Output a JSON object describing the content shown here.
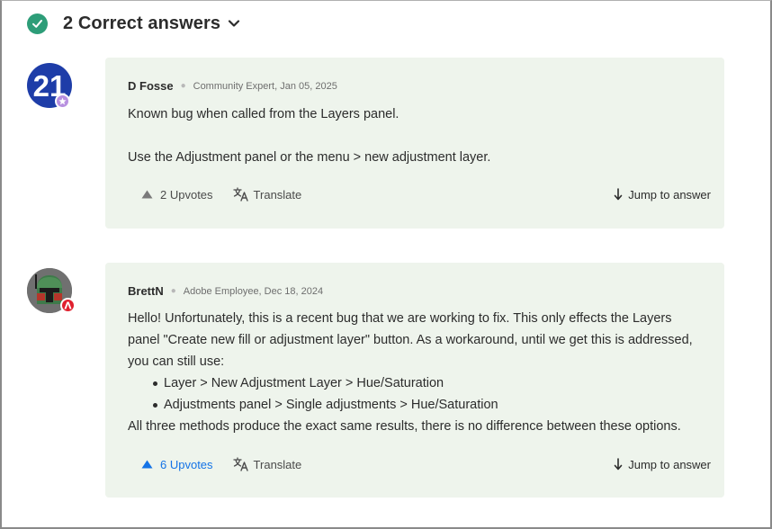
{
  "header": {
    "title": "2 Correct answers",
    "icon": "check-circle-icon",
    "toggle_icon": "chevron-down-icon"
  },
  "answers": [
    {
      "avatar_text": "21",
      "author": "D Fosse",
      "role_date": "Community Expert, Jan 05, 2025",
      "paragraphs": [
        "Known bug when called from the Layers panel.",
        "Use the Adjustment panel or the menu > new adjustment layer."
      ],
      "upvotes": "2 Upvotes",
      "upvoted": false,
      "translate": "Translate",
      "jump": "Jump to answer"
    },
    {
      "author": "BrettN",
      "role_date": "Adobe Employee, Dec 18, 2024",
      "intro": "Hello! Unfortunately, this is a recent bug that we are working to fix. This only effects the Layers panel \"Create new fill or adjustment layer\" button. As a workaround, until we get this is addressed, you can still use:",
      "bullets": [
        "Layer > New Adjustment Layer > Hue/Saturation",
        "Adjustments panel > Single adjustments > Hue/Saturation"
      ],
      "outro": "All three methods produce the exact same results, there is no difference between these options.",
      "upvotes": "6 Upvotes",
      "upvoted": true,
      "translate": "Translate",
      "jump": "Jump to answer"
    }
  ],
  "colors": {
    "accent": "#1473e6",
    "correct": "#2d9d78",
    "card_bg": "#eef4ec",
    "adobe_red": "#e0202e"
  }
}
